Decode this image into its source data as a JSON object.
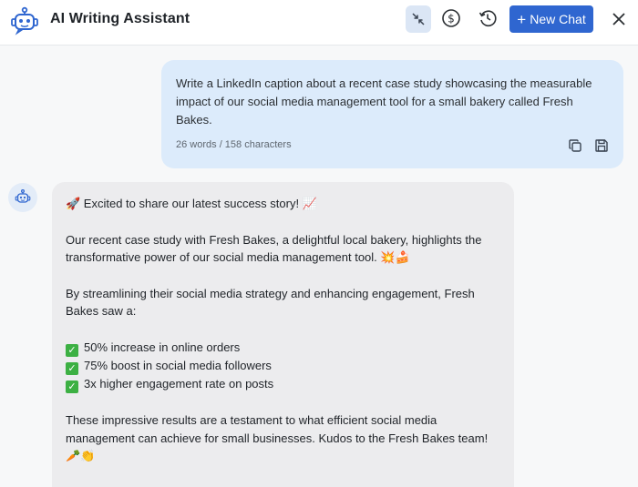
{
  "header": {
    "title": "AI Writing Assistant",
    "new_chat_label": "New Chat",
    "icons": [
      "collapse-icon",
      "dollar-icon",
      "history-icon",
      "close-icon"
    ]
  },
  "user_message": {
    "text": "Write a LinkedIn caption about a recent case study showcasing the measurable impact of our social media management tool for a small bakery called Fresh Bakes.",
    "meta": "26 words / 158 characters"
  },
  "assistant_message": {
    "intro": "🚀 Excited to share our latest success story! 📈",
    "para1": "Our recent case study with Fresh Bakes, a delightful local bakery, highlights the transformative power of our social media management tool. 💥🍰",
    "para2": "By streamlining their social media strategy and enhancing engagement, Fresh Bakes saw a:",
    "results": [
      "50% increase in online orders",
      "75% boost in social media followers",
      "3x higher engagement rate on posts"
    ],
    "para3": "These impressive results are a testament to what efficient social media management can achieve for small businesses. Kudos to the Fresh Bakes team!",
    "para3_emoji": "🥕👏"
  },
  "colors": {
    "accent": "#2f66d0",
    "user_bubble": "#dcebfb",
    "assistant_bubble": "#ececee",
    "check": "#3cb043"
  }
}
